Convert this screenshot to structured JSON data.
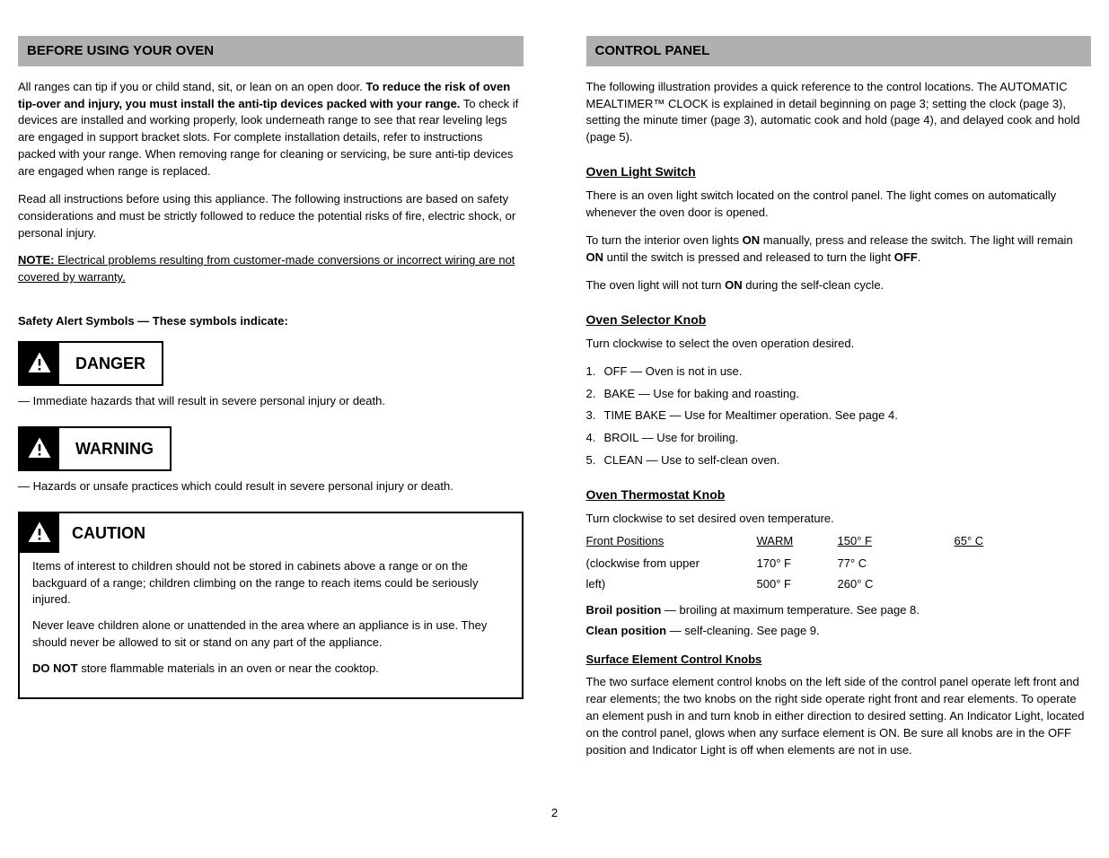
{
  "left": {
    "header": "BEFORE USING YOUR OVEN",
    "p1_prefix": "All ranges can tip if you or child stand, sit, or lean on an open door. ",
    "p1_bold": "To reduce the risk of oven tip-over and injury, you must install the anti-tip devices packed with your range.",
    "p1_suffix": " To check if devices are installed and working properly, look underneath range to see that rear leveling legs are engaged in support bracket slots. For complete installation details, refer to instructions packed with your range. When removing range for cleaning or servicing, be sure anti-tip devices are engaged when range is replaced.",
    "p2": "Read all instructions before using this appliance. The following instructions are based on safety considerations and must be strictly followed to reduce the potential risks of fire, electric shock, or personal injury.",
    "note_label": "NOTE: ",
    "note_text": "Electrical problems resulting from customer-made conversions or incorrect wiring are not covered by warranty.",
    "alerts_intro": "Safety Alert Symbols — These symbols indicate:",
    "danger_label": "DANGER",
    "danger_def": " — Immediate hazards that will result in severe personal injury or death.",
    "warning_label": "WARNING",
    "warning_def": " — Hazards or unsafe practices which could result in severe personal injury or death.",
    "caution_label": "CAUTION",
    "caution_p1": "Items of interest to children should not be stored in cabinets above a range or on the backguard of a range; children climbing on the range to reach items could be seriously injured.",
    "caution_p2": "Never leave children alone or unattended in the area where an appliance is in use. They should never be allowed to sit or stand on any part of the appliance.",
    "caution_p3_prefix": "DO NOT",
    "caution_p3_rest": " store flammable materials in an oven or near the cooktop."
  },
  "right": {
    "header": "CONTROL PANEL",
    "intro": "The following illustration provides a quick reference to the control locations. The AUTOMATIC MEALTIMER™ CLOCK is explained in detail beginning on page 3; setting the clock (page 3), setting the minute timer (page 3), automatic cook and hold (page 4), and delayed cook and hold (page 5).",
    "sub1": "Oven Light Switch",
    "sub1_1": "There is an oven light switch located on the control panel. The light comes on automatically whenever the oven door is opened.",
    "sub1_2_prefix": "To turn the interior oven lights ",
    "sub1_2_on": "ON",
    "sub1_2_mid": " manually, press and release the switch. The light will remain ",
    "sub1_2_on2": "ON",
    "sub1_2_mid2": " until the switch is pressed and released to turn the light ",
    "sub1_2_off": "OFF",
    "sub1_2_end": ".",
    "sub1_3_prefix": "The oven light will not turn ",
    "sub1_3_on": "ON",
    "sub1_3_end": " during the self-clean cycle.",
    "sub2": "Oven Selector Knob",
    "sub2_p": "Turn clockwise to select the oven operation desired.",
    "sub2_items_label": "",
    "sub2_items": [
      {
        "num": "1.",
        "text": "OFF — Oven is not in use."
      },
      {
        "num": "2.",
        "text": "BAKE — Use for baking and roasting."
      },
      {
        "num": "3.",
        "text": "TIME BAKE — Use for Mealtimer operation. See page 4."
      },
      {
        "num": "4.",
        "text": "BROIL — Use for broiling."
      },
      {
        "num": "5.",
        "text": "CLEAN — Use to self-clean oven."
      }
    ],
    "sub3": "Oven Thermostat Knob",
    "sub3_line1": "Turn clockwise to set desired oven temperature.",
    "sub3_line2_prefix": "",
    "sub3_line2_bold": "Broil position",
    "sub3_line2_rest": " — broiling at maximum temperature. See page 8.",
    "sub3_line3_prefix": "",
    "sub3_line3_bold": "Clean position",
    "sub3_line3_rest": " — self-cleaning. See page 9.",
    "fp": {
      "col1": "Front Positions",
      "col2": "WARM",
      "col3": "150° F",
      "col4": "65° C",
      "rows": [
        {
          "c1": "(clockwise from upper",
          "c2": "170° F",
          "c3": "77° C",
          "c4": ""
        },
        {
          "c1": "left)",
          "c2": "500° F",
          "c3": "260° C",
          "c4": ""
        }
      ]
    },
    "sub4": "Surface Element Control Knobs",
    "sub4_p": "The two surface element control knobs on the left side of the control panel operate left front and rear elements; the two knobs on the right side operate right front and rear elements. To operate an element push in and turn knob in either direction to desired setting. An Indicator Light, located on the control panel, glows when any surface element is ON. Be sure all knobs are in the OFF position and Indicator Light is off when elements are not in use."
  },
  "footer": "2"
}
